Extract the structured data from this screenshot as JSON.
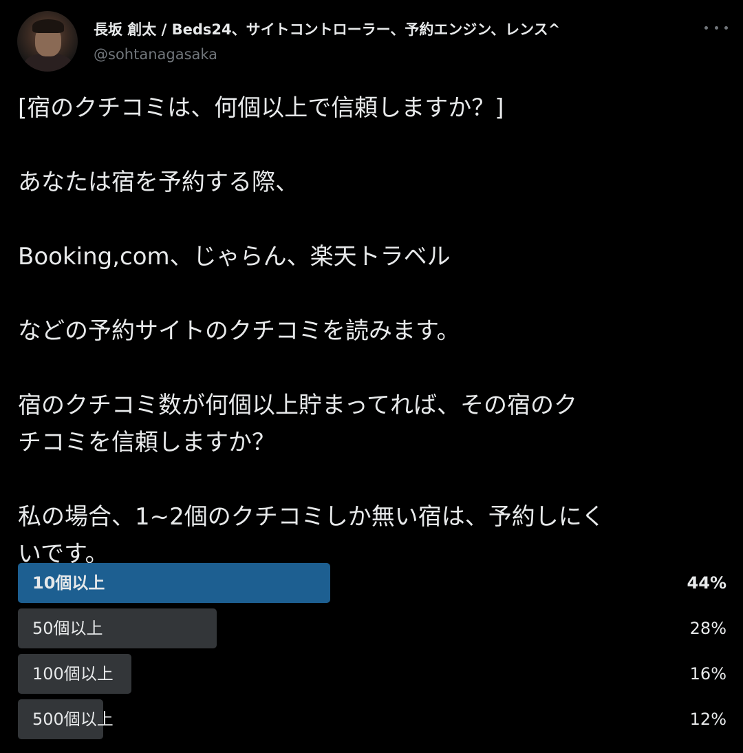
{
  "author": {
    "display_name": "長坂 創太 / Beds24、サイトコントローラー、予約エンジン、レンス^",
    "handle": "@sohtanagasaka",
    "avatar_icon": "profile-photo-avatar",
    "more_icon": "more-horizontal-icon"
  },
  "tweet": {
    "lines": [
      "[宿のクチコミは、何個以上で信頼しますか？]",
      "",
      "あなたは宿を予約する際、",
      "",
      "Booking,com、じゃらん、楽天トラベル",
      "",
      "などの予約サイトのクチコミを読みます。",
      "",
      "宿のクチコミ数が何個以上貯まってれば、その宿のク",
      "チコミを信頼しますか？",
      "",
      "私の場合、1~2個のクチコミしか無い宿は、予約しにく",
      "いです。"
    ]
  },
  "poll": {
    "colors": {
      "winner_bar": "#1d5f91",
      "other_bar": "#333639",
      "background": "#000000",
      "text": "#e7e9ea",
      "secondary_text": "#71767b"
    },
    "options": [
      {
        "label": "10個以上",
        "percent_text": "44%",
        "percent": 44,
        "winner": true
      },
      {
        "label": "50個以上",
        "percent_text": "28%",
        "percent": 28,
        "winner": false
      },
      {
        "label": "100個以上",
        "percent_text": "16%",
        "percent": 16,
        "winner": false
      },
      {
        "label": "500個以上",
        "percent_text": "12%",
        "percent": 12,
        "winner": false
      }
    ]
  }
}
